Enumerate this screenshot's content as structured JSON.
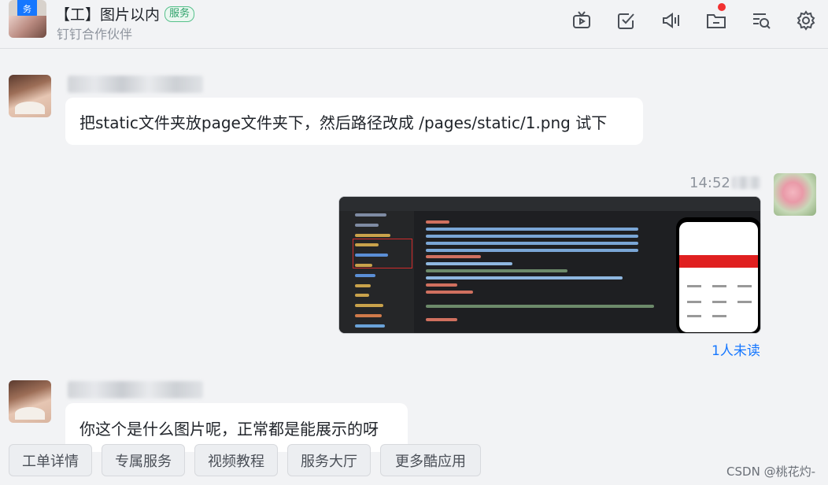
{
  "header": {
    "group_tag": "务",
    "title": "【工】图片以内",
    "badge": "服务",
    "subtitle": "钉钉合作伙伴",
    "toolbar_icons": [
      "live-icon",
      "todo-check-icon",
      "voice-call-icon",
      "folder-icon",
      "search-history-icon",
      "settings-gear-icon"
    ]
  },
  "messages": [
    {
      "side": "left",
      "text": "把static文件夹放page文件夹下，然后路径改成 /pages/static/1.png  试下"
    },
    {
      "side": "right",
      "time": "14:52",
      "read_status": "1人未读"
    },
    {
      "side": "left",
      "text": "你这个是什么图片呢，正常都是能展示的呀"
    }
  ],
  "quick_buttons": [
    "工单详情",
    "专属服务",
    "视频教程",
    "服务大厅",
    "更多酷应用"
  ],
  "watermark": "CSDN @桃花灼-",
  "colors": {
    "accent": "#1677ff",
    "badge_green": "#2fa26a",
    "notification_dot": "#f23030"
  }
}
